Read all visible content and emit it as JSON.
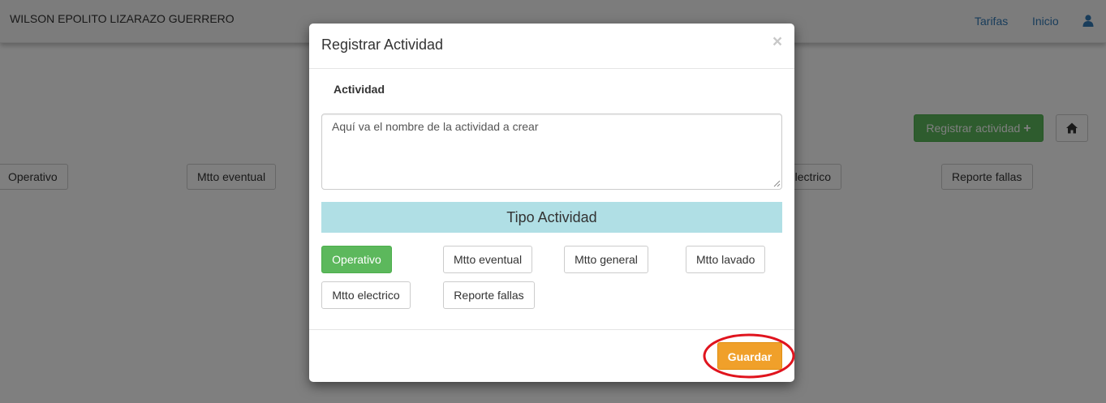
{
  "navbar": {
    "brand": "WILSON EPOLITO LIZARAZO GUERRERO",
    "links": [
      "Tarifas",
      "Inicio"
    ],
    "user_icon": "user-icon"
  },
  "page": {
    "register_button": "Registrar actividad",
    "register_icon": "plus-icon",
    "home_icon": "home-icon",
    "filter_buttons": [
      "Operativo",
      "Mtto eventual",
      "Mtto electrico",
      "Reporte fallas"
    ]
  },
  "modal": {
    "title": "Registrar Actividad",
    "close_glyph": "×",
    "field_label": "Actividad",
    "textarea_placeholder": "Aquí va el nombre de la actividad a crear",
    "type_heading": "Tipo Actividad",
    "types": [
      "Operativo",
      "Mtto eventual",
      "Mtto general",
      "Mtto lavado",
      "Mtto electrico",
      "Reporte fallas"
    ],
    "selected_type": "Operativo",
    "save_button": "Guardar"
  },
  "colors": {
    "success": "#5cb85c",
    "warning": "#f0a02a",
    "info_banner": "#b0dfe5",
    "link": "#337ab7",
    "highlight_ring": "#e0141e"
  }
}
